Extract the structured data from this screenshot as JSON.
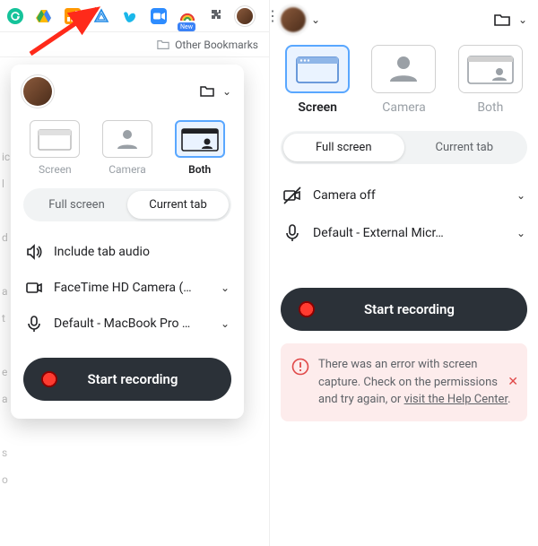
{
  "browser": {
    "new_badge": "New",
    "other_bookmarks": "Other Bookmarks"
  },
  "left_popup": {
    "modes": {
      "screen": "Screen",
      "camera": "Camera",
      "both": "Both"
    },
    "toggle": {
      "full_screen": "Full screen",
      "current_tab": "Current tab"
    },
    "opts": {
      "audio": "Include tab audio",
      "camera": "FaceTime HD Camera (…",
      "mic": "Default - MacBook Pro …"
    },
    "start": "Start recording"
  },
  "right_panel": {
    "modes": {
      "screen": "Screen",
      "camera": "Camera",
      "both": "Both"
    },
    "toggle": {
      "full_screen": "Full screen",
      "current_tab": "Current tab"
    },
    "opts": {
      "camera": "Camera off",
      "mic": "Default - External Micr…"
    },
    "start": "Start recording",
    "alert": {
      "text_a": "There was an error with screen capture. Check on the permissions and try again, or ",
      "link": "visit the Help Center",
      "text_b": "."
    }
  }
}
